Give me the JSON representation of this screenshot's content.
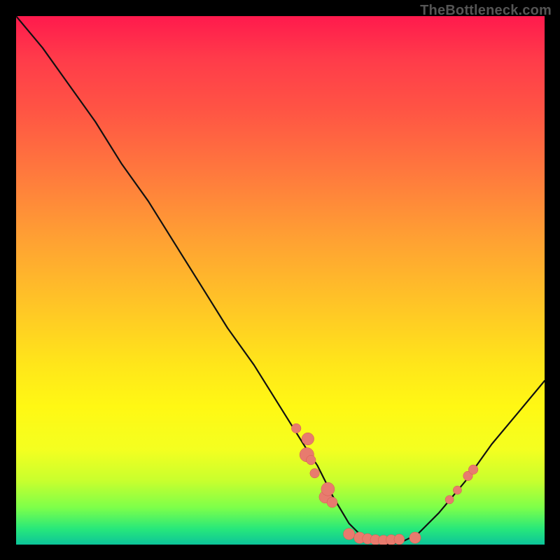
{
  "watermark": "TheBottleneck.com",
  "colors": {
    "background": "#000000",
    "curve": "#111111",
    "marker_fill": "#e87b6e",
    "marker_stroke": "#d3584f"
  },
  "chart_data": {
    "type": "line",
    "title": "",
    "xlabel": "",
    "ylabel": "",
    "xlim": [
      0,
      100
    ],
    "ylim": [
      0,
      100
    ],
    "grid": false,
    "note": "Values are approximate, read from pixel positions; axes carry no printed tick labels.",
    "series": [
      {
        "name": "bottleneck-curve",
        "x": [
          0,
          5,
          10,
          15,
          20,
          25,
          30,
          35,
          40,
          45,
          50,
          55,
          57,
          60,
          63,
          65,
          68,
          70,
          73,
          76,
          80,
          85,
          90,
          95,
          100
        ],
        "y": [
          100,
          94,
          87,
          80,
          72,
          65,
          57,
          49,
          41,
          34,
          26,
          18,
          15,
          9,
          4,
          2,
          0.5,
          0,
          0.5,
          2,
          6,
          12,
          19,
          25,
          31
        ]
      }
    ],
    "markers": [
      {
        "name": "left-cluster-1",
        "x": 53.0,
        "y": 22,
        "r": 1.0
      },
      {
        "name": "left-cluster-2",
        "x": 55.0,
        "y": 17,
        "r": 1.5
      },
      {
        "name": "left-cluster-3",
        "x": 55.8,
        "y": 16,
        "r": 1.0
      },
      {
        "name": "left-cluster-4",
        "x": 55.2,
        "y": 20,
        "r": 1.3
      },
      {
        "name": "left-cluster-5",
        "x": 56.5,
        "y": 13.5,
        "r": 1.0
      },
      {
        "name": "left-cluster-6",
        "x": 58.5,
        "y": 9.0,
        "r": 1.3
      },
      {
        "name": "left-cluster-7",
        "x": 59.0,
        "y": 10.5,
        "r": 1.4
      },
      {
        "name": "left-cluster-8",
        "x": 59.8,
        "y": 8.0,
        "r": 1.1
      },
      {
        "name": "bottom-1",
        "x": 63.0,
        "y": 2.0,
        "r": 1.2
      },
      {
        "name": "bottom-2",
        "x": 65.0,
        "y": 1.3,
        "r": 1.2
      },
      {
        "name": "bottom-3",
        "x": 66.5,
        "y": 1.1,
        "r": 1.1
      },
      {
        "name": "bottom-4",
        "x": 68.0,
        "y": 0.9,
        "r": 1.1
      },
      {
        "name": "bottom-5",
        "x": 69.5,
        "y": 0.8,
        "r": 1.1
      },
      {
        "name": "bottom-6",
        "x": 71.0,
        "y": 0.9,
        "r": 1.1
      },
      {
        "name": "bottom-7",
        "x": 72.5,
        "y": 1.0,
        "r": 1.1
      },
      {
        "name": "bottom-8",
        "x": 75.5,
        "y": 1.3,
        "r": 1.2
      },
      {
        "name": "right-1",
        "x": 82.0,
        "y": 8.5,
        "r": 0.9
      },
      {
        "name": "right-2",
        "x": 83.5,
        "y": 10.3,
        "r": 0.9
      },
      {
        "name": "right-3",
        "x": 85.5,
        "y": 13.0,
        "r": 1.0
      },
      {
        "name": "right-4",
        "x": 86.5,
        "y": 14.2,
        "r": 1.0
      }
    ]
  }
}
